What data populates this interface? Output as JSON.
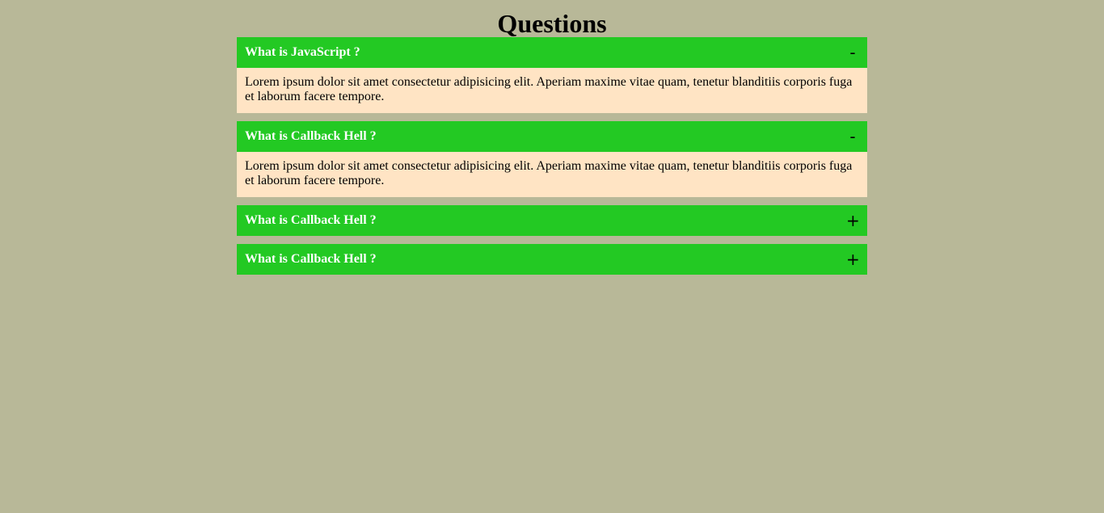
{
  "page": {
    "title": "Questions"
  },
  "faqs": [
    {
      "question": "What is JavaScript ?",
      "toggle": "-",
      "expanded": true,
      "answer": "Lorem ipsum dolor sit amet consectetur adipisicing elit. Aperiam maxime vitae quam, tenetur blanditiis corporis fuga et laborum facere tempore."
    },
    {
      "question": "What is Callback Hell ?",
      "toggle": "-",
      "expanded": true,
      "answer": "Lorem ipsum dolor sit amet consectetur adipisicing elit. Aperiam maxime vitae quam, tenetur blanditiis corporis fuga et laborum facere tempore."
    },
    {
      "question": "What is Callback Hell ?",
      "toggle": "+",
      "expanded": false
    },
    {
      "question": "What is Callback Hell ?",
      "toggle": "+",
      "expanded": false
    }
  ],
  "colors": {
    "background": "#b8b898",
    "header": "#23c923",
    "answer_bg": "#ffe4c4"
  }
}
